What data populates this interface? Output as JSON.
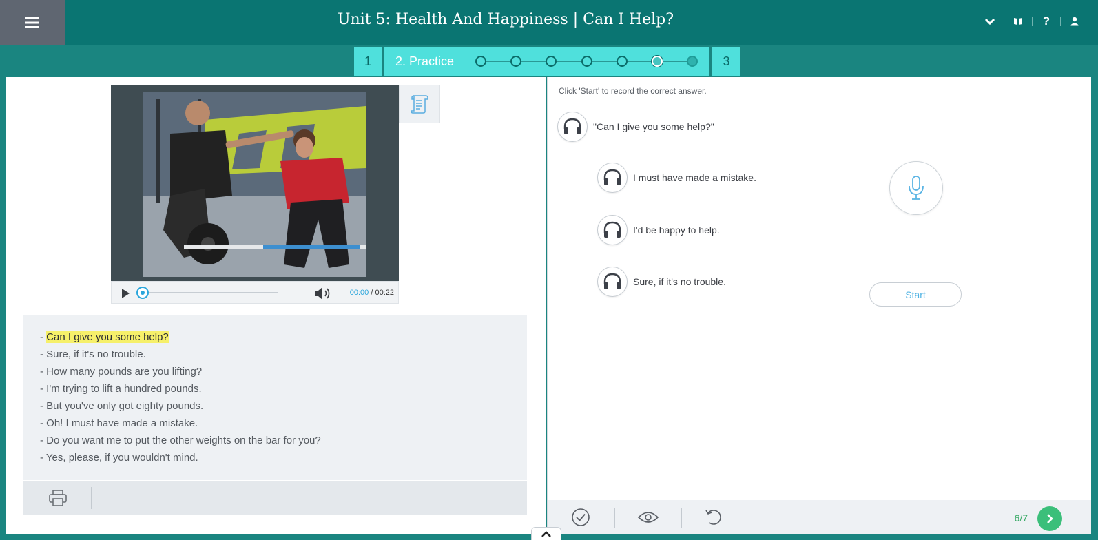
{
  "header": {
    "title": "Unit 5: Health And Happiness | Can I Help?",
    "icons": [
      "menu-icon",
      "chevron-down-icon",
      "book-icon",
      "help-icon",
      "user-icon"
    ],
    "help_label": "?"
  },
  "steps": {
    "step1_label": "1",
    "step2_label": "2. Practice",
    "step3_label": "3",
    "current_dot": 6,
    "total_dots": 7
  },
  "video": {
    "current_time": "00:00",
    "separator": " / ",
    "duration": "00:22",
    "progress": 0
  },
  "transcript": {
    "lines": [
      {
        "prefix": "- ",
        "text": "Can I give you some help?"
      },
      {
        "prefix": "- ",
        "text": "Sure, if it's no trouble."
      },
      {
        "prefix": "- ",
        "text": "How many pounds are you lifting?"
      },
      {
        "prefix": "- ",
        "text": "I'm trying to lift a hundred pounds."
      },
      {
        "prefix": "- ",
        "text": "But you've only got eighty pounds."
      },
      {
        "prefix": "- ",
        "text": "Oh! I must have made a mistake."
      },
      {
        "prefix": "- ",
        "text": "Do you want me to put the other weights on the bar for you?"
      },
      {
        "prefix": "- ",
        "text": "Yes, please, if you wouldn't mind."
      }
    ]
  },
  "exercise": {
    "instruction": "Click 'Start' to record the correct answer.",
    "prompt": "\"Can I give you some help?\"",
    "options": [
      "I must have made a mistake.",
      "I'd be happy to help.",
      "Sure, if it's no trouble."
    ],
    "start_label": "Start",
    "progress_label": "6/7"
  },
  "colors": {
    "header_bg": "#0a7572",
    "step_bg": "#4fe0dc",
    "accent_blue": "#2aa6dc",
    "accent_green": "#3bbf7a",
    "highlight": "#f6f06a"
  }
}
